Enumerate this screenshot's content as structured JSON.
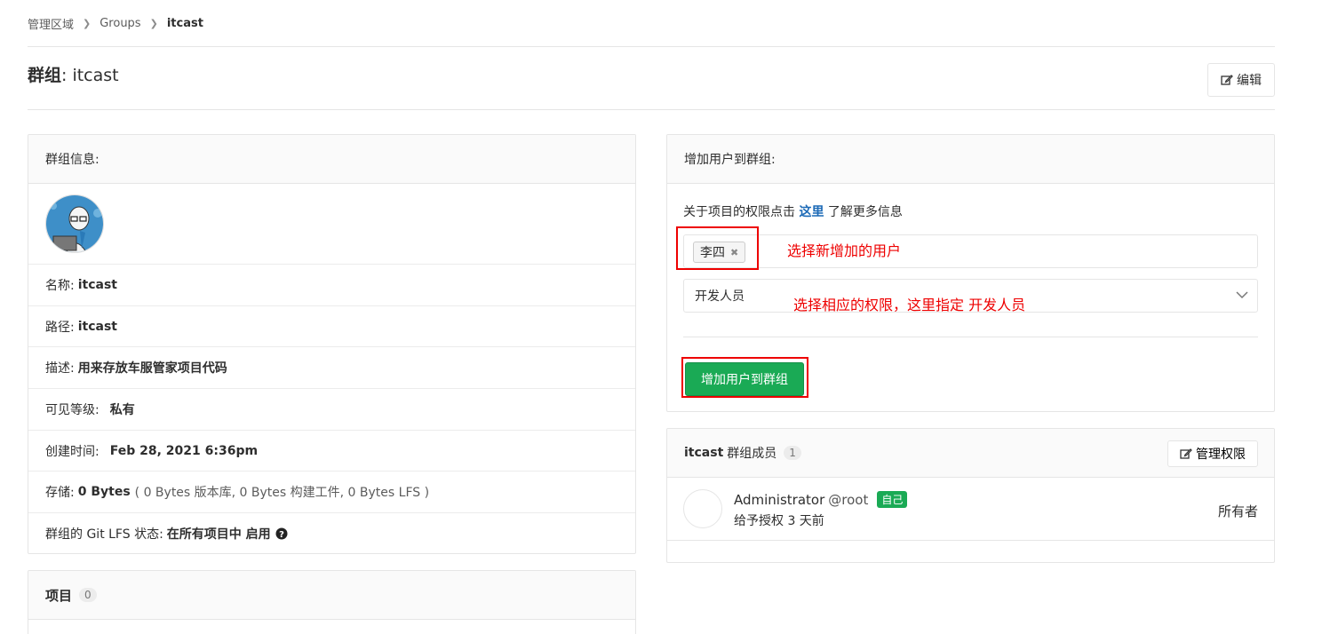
{
  "breadcrumb": [
    "管理区域",
    "Groups",
    "itcast"
  ],
  "title": {
    "prefix": "群组",
    "name": ": itcast"
  },
  "edit_label": "编辑",
  "group_info": {
    "header": "群组信息:",
    "name_label": "名称:",
    "name_value": "itcast",
    "path_label": "路径:",
    "path_value": "itcast",
    "desc_label": "描述:",
    "desc_value": "用来存放车服管家项目代码",
    "visibility_label": "可见等级:",
    "visibility_value": "私有",
    "created_label": "创建时间:",
    "created_value": "Feb 28, 2021 6:36pm",
    "storage_label": "存储:",
    "storage_value": "0 Bytes",
    "storage_detail": "( 0 Bytes 版本库, 0 Bytes 构建工件, 0 Bytes LFS )",
    "lfs_label": "群组的 Git LFS 状态:",
    "lfs_value": "在所有项目中 启用"
  },
  "projects": {
    "header": "项目",
    "count": "0"
  },
  "add_user": {
    "header": "增加用户到群组:",
    "info_before": "关于项目的权限点击",
    "info_link": "这里",
    "info_after": "了解更多信息",
    "selected_user": "李四",
    "role": "开发人员",
    "button": "增加用户到群组"
  },
  "annotations": {
    "user": "选择新增加的用户",
    "role": "选择相应的权限，这里指定 开发人员"
  },
  "members": {
    "group": "itcast",
    "header": "群组成员",
    "count": "1",
    "manage_label": "管理权限",
    "list": [
      {
        "name": "Administrator",
        "username": "@root",
        "badge": "自己",
        "granted": "给予授权 3 天前",
        "role": "所有者"
      }
    ]
  },
  "colors": {
    "accent_green": "#1aaa55",
    "link_blue": "#1b69b6",
    "annotation_red": "#e00000"
  }
}
